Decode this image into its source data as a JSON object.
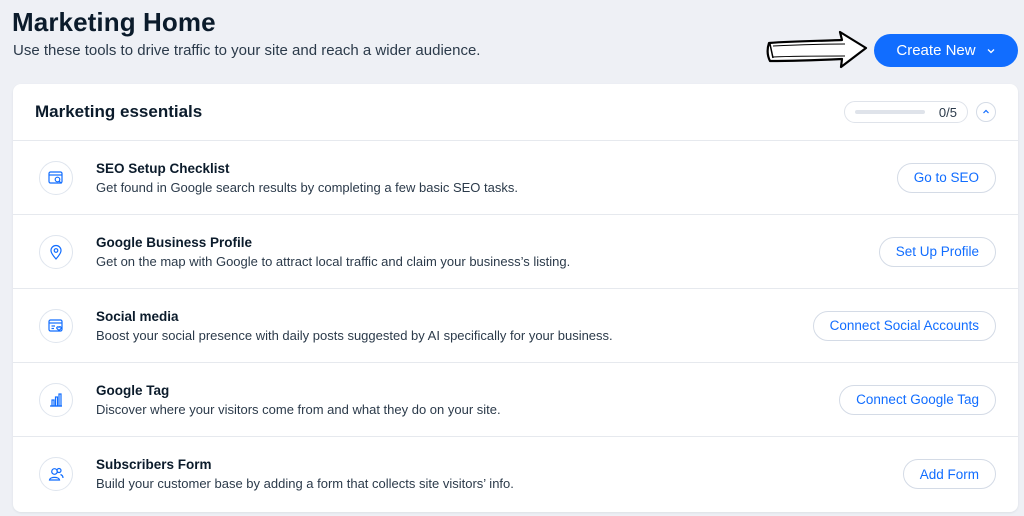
{
  "header": {
    "title": "Marketing Home",
    "subtitle": "Use these tools to drive traffic to your site and reach a wider audience.",
    "create_label": "Create New"
  },
  "card": {
    "title": "Marketing essentials",
    "progress_text": "0/5",
    "progress_fraction": 0
  },
  "items": [
    {
      "icon": "seo-icon",
      "title": "SEO Setup Checklist",
      "desc": "Get found in Google search results by completing a few basic SEO tasks.",
      "button": "Go to SEO"
    },
    {
      "icon": "location-pin-icon",
      "title": "Google Business Profile",
      "desc": "Get on the map with Google to attract local traffic and claim your business’s listing.",
      "button": "Set Up Profile"
    },
    {
      "icon": "social-post-icon",
      "title": "Social media",
      "desc": "Boost your social presence with daily posts suggested by AI specifically for your business.",
      "button": "Connect Social Accounts"
    },
    {
      "icon": "bar-chart-icon",
      "title": "Google Tag",
      "desc": "Discover where your visitors come from and what they do on your site.",
      "button": "Connect Google Tag"
    },
    {
      "icon": "subscribers-icon",
      "title": "Subscribers Form",
      "desc": "Build your customer base by adding a form that collects site visitors’ info.",
      "button": "Add Form"
    }
  ],
  "colors": {
    "accent": "#116dff",
    "background": "#eef0f5",
    "text": "#162d3d"
  }
}
